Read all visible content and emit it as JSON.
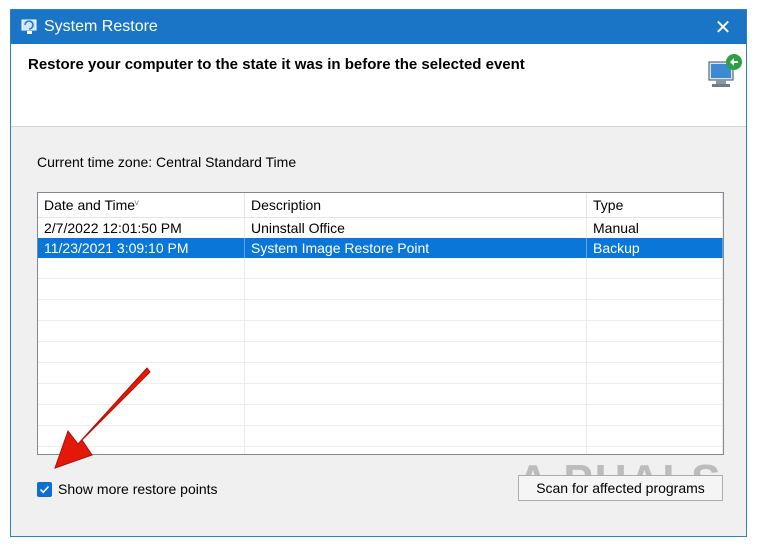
{
  "window": {
    "title": "System Restore",
    "close_glyph": "✕",
    "header": "Restore your computer to the state it was in before the selected event"
  },
  "timezone_label": "Current time zone: Central Standard Time",
  "table": {
    "columns": [
      "Date and Time",
      "Description",
      "Type"
    ],
    "sort_glyph": "˅",
    "rows": [
      {
        "date": "2/7/2022 12:01:50 PM",
        "description": "Uninstall Office",
        "type": "Manual",
        "selected": false
      },
      {
        "date": "11/23/2021 3:09:10 PM",
        "description": "System Image Restore Point",
        "type": "Backup",
        "selected": true
      }
    ]
  },
  "checkbox": {
    "label": "Show more restore points",
    "checked": true
  },
  "scan_button": "Scan for affected programs",
  "watermark": "A  PUALS",
  "colors": {
    "accent": "#0a76d8",
    "titlebar": "#1a75c7",
    "annotation_arrow": "#e3170a"
  }
}
